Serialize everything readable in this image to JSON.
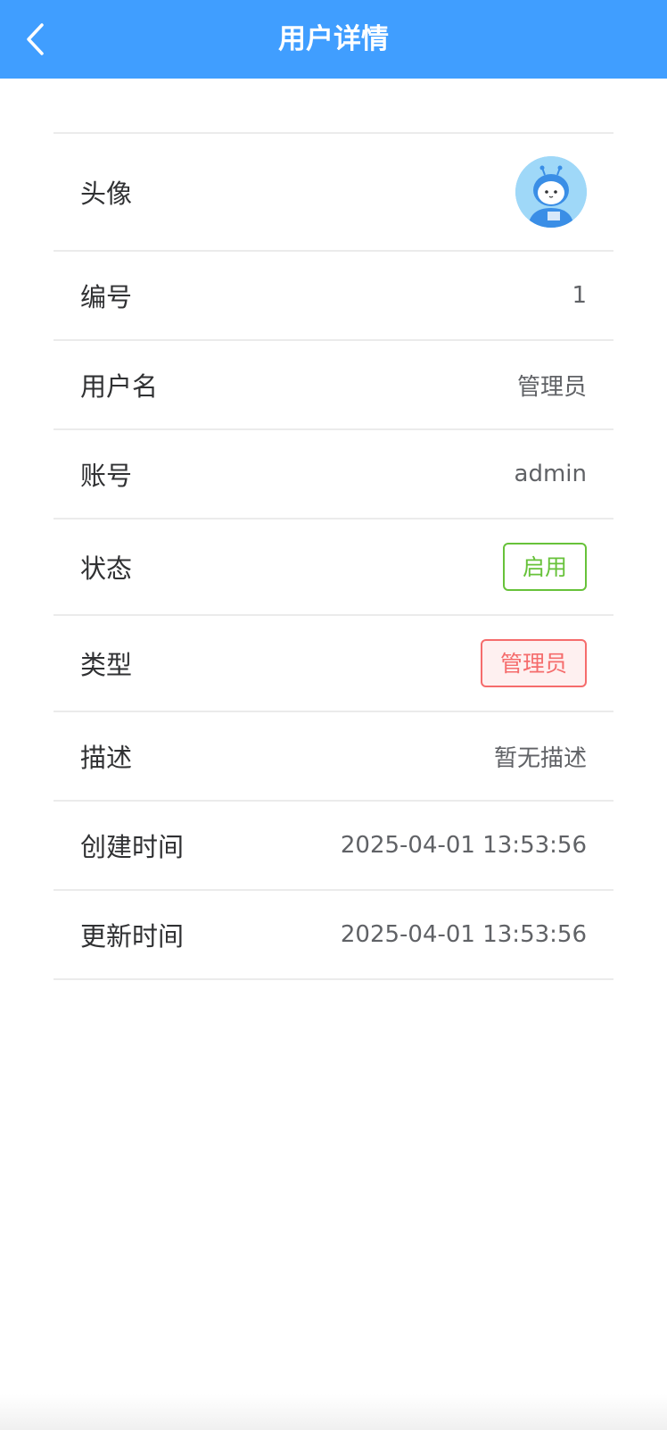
{
  "header": {
    "title": "用户详情",
    "back_icon": "chevron-left-icon",
    "background_color": "#409eff"
  },
  "details": {
    "avatar_label": "头像",
    "id_label": "编号",
    "id_value": "1",
    "username_label": "用户名",
    "username_value": "管理员",
    "account_label": "账号",
    "account_value": "admin",
    "status_label": "状态",
    "status_value": "启用",
    "type_label": "类型",
    "type_value": "管理员",
    "description_label": "描述",
    "description_value": "暂无描述",
    "created_label": "创建时间",
    "created_value": "2025-04-01 13:53:56",
    "updated_label": "更新时间",
    "updated_value": "2025-04-01 13:53:56"
  },
  "colors": {
    "status_success": "#67c23a",
    "type_danger": "#f56c6c"
  }
}
